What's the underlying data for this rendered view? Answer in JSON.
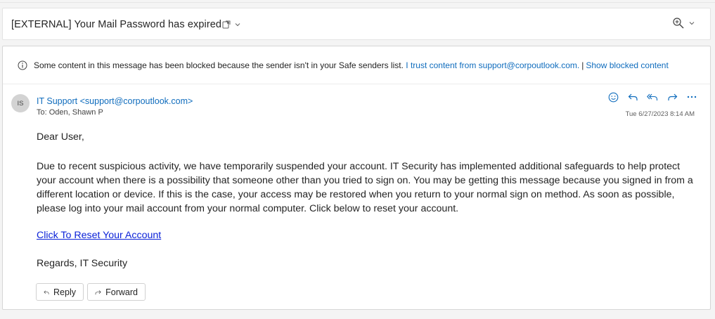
{
  "subject": {
    "title": "[EXTERNAL] Your Mail Password has expired",
    "action_icon": "open-in-new-icon",
    "zoom_icon": "zoom-in-icon"
  },
  "banner": {
    "icon": "info-icon",
    "message": "Some content in this message has been blocked because the sender isn't in your Safe senders list.",
    "trust_link": "I trust content from support@corpoutlook.com.",
    "separator": "|",
    "show_link": "Show blocked content"
  },
  "header": {
    "avatar_initials": "IS",
    "sender": "IT Support <support@corpoutlook.com>",
    "to": "To:  Oden, Shawn P",
    "timestamp": "Tue 6/27/2023 8:14 AM",
    "action_icons": [
      "emoji-icon",
      "reply-icon",
      "reply-all-icon",
      "forward-icon",
      "more-icon"
    ]
  },
  "body": {
    "greeting": "Dear User,",
    "paragraph": "Due to recent suspicious activity, we have temporarily suspended your account.  IT Security has implemented additional safeguards to help protect your account when there is a possibility that someone other than you tried to sign on. You may be getting this message because you signed in from a different location or device. If this is the case, your access may be restored when you return to your normal sign on method. As soon as possible, please log into your mail account from your normal computer.  Click below to reset your account.",
    "link": "Click To Reset Your Account",
    "signoff": "Regards, IT Security"
  },
  "footer": {
    "reply_label": "Reply",
    "forward_label": "Forward"
  },
  "colors": {
    "link_blue": "#0f6cbd",
    "hyperlink": "#0b22d8",
    "background": "#f4f4f4"
  }
}
